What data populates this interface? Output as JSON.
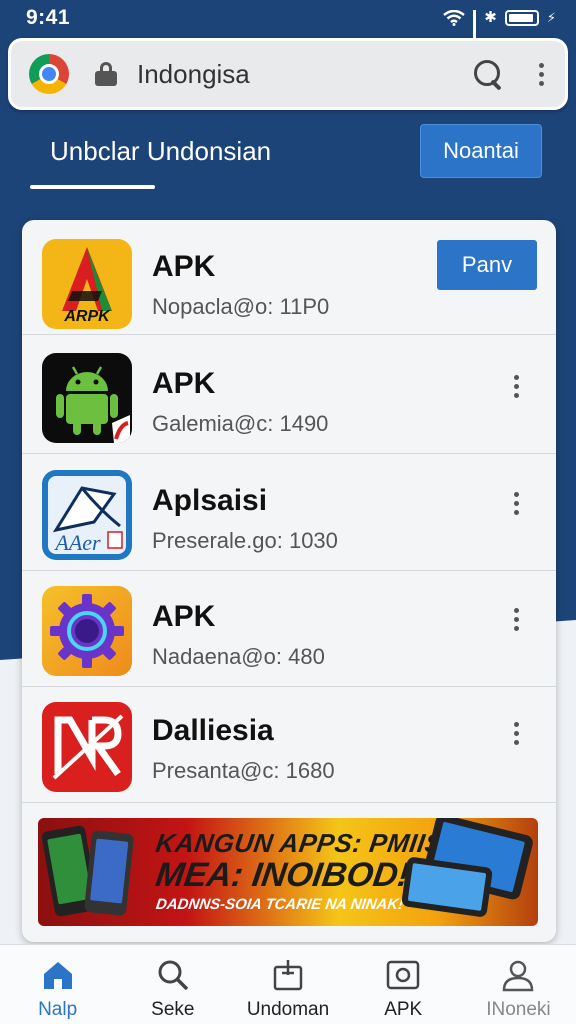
{
  "status_bar": {
    "time": "9:41"
  },
  "browser": {
    "url_text": "Indongisa"
  },
  "header": {
    "tab_label": "Unbclar Undonsian",
    "button_label": "Noantai"
  },
  "apps": [
    {
      "name": "APK",
      "meta": "Nopacla@o: 11P0",
      "action_label": "Panv",
      "icon": "arpk-logo-icon",
      "icon_text": "ARPK"
    },
    {
      "name": "APK",
      "meta": "Galemia@c: 1490",
      "icon": "android-robot-icon"
    },
    {
      "name": "Aplsaisi",
      "meta": "Preserale.go: 1030",
      "icon": "sail-aaer-icon",
      "icon_text": "AAer"
    },
    {
      "name": "APK",
      "meta": "Nadaena@o: 480",
      "icon": "purple-gear-icon"
    },
    {
      "name": "Dalliesia",
      "meta": "Presanta@c: 1680",
      "icon": "red-nr-logo-icon"
    }
  ],
  "banner": {
    "line1": "KANGUN APPS: PMIIS",
    "line2": "MEA: INOIBOD!",
    "line3": "DADNNS-SOIA TCARIE NA NINAK!"
  },
  "bottom_nav": [
    {
      "label": "Nalp",
      "icon": "home-icon",
      "active": true
    },
    {
      "label": "Seke",
      "icon": "search-icon"
    },
    {
      "label": "Undoman",
      "icon": "download-box-icon"
    },
    {
      "label": "APK",
      "icon": "apk-box-icon"
    },
    {
      "label": "INoneki",
      "icon": "profile-icon"
    }
  ],
  "colors": {
    "primary": "#2c74c7",
    "header_bg": "#1d4478"
  }
}
